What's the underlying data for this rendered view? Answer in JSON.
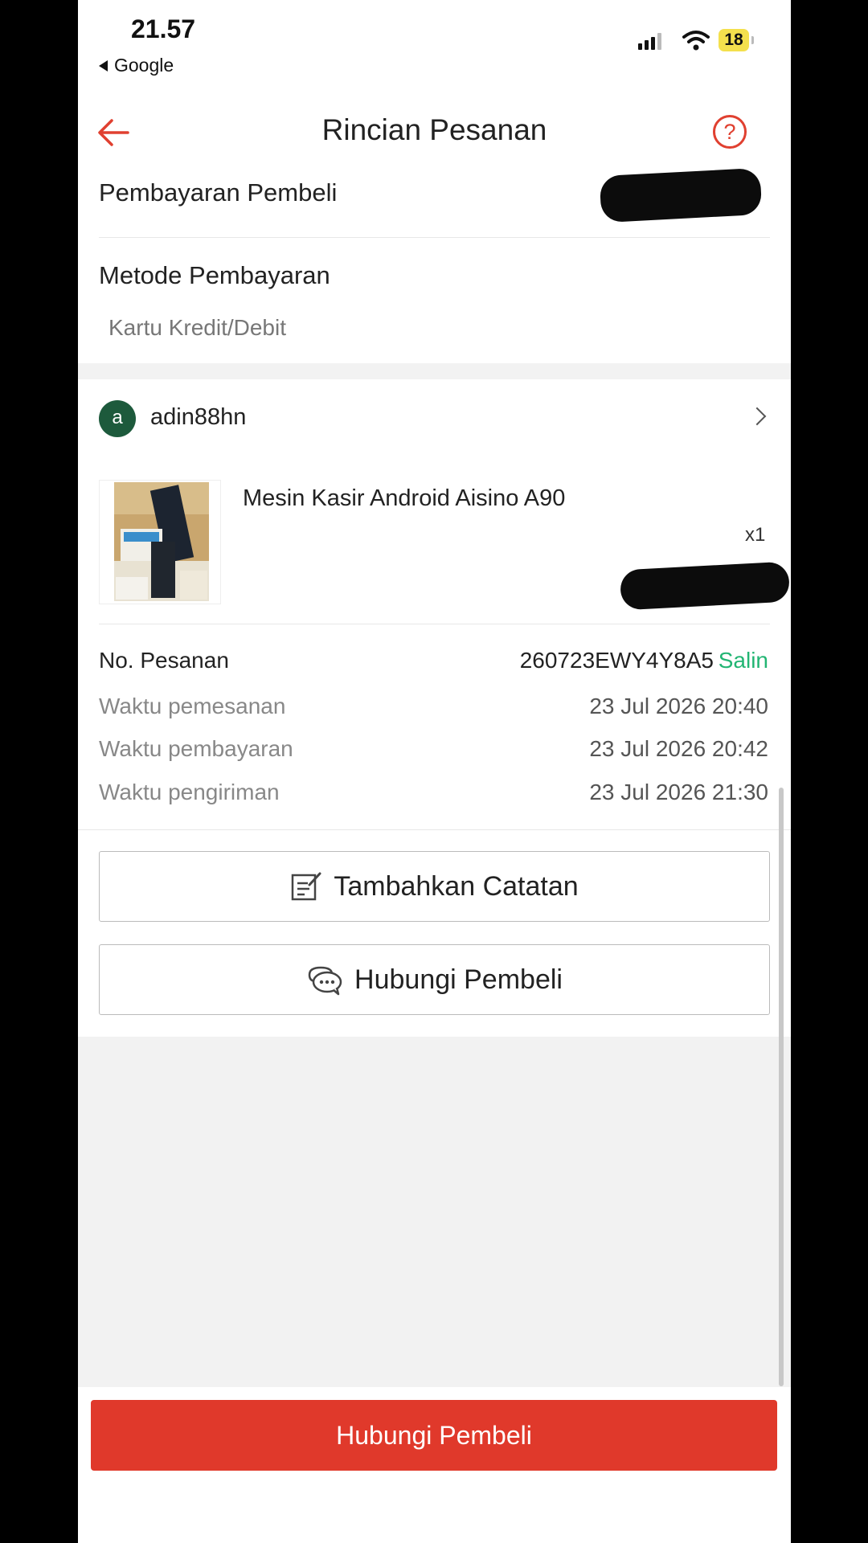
{
  "status_bar": {
    "time": "21.57",
    "back_app": "Google",
    "battery": "18"
  },
  "header": {
    "title": "Rincian Pesanan",
    "help_glyph": "?"
  },
  "payment": {
    "buyer_payment_label": "Pembayaran Pembeli",
    "method_label": "Metode Pembayaran",
    "method_value": "Kartu Kredit/Debit"
  },
  "shop": {
    "avatar_letter": "a",
    "name": "adin88hn"
  },
  "product": {
    "name": "Mesin Kasir Android Aisino A90",
    "quantity": "x1"
  },
  "order": {
    "number_label": "No. Pesanan",
    "number_value": "260723EWY4Y8A5",
    "copy_label": "Salin",
    "rows": [
      {
        "label": "Waktu pemesanan",
        "value": "23 Jul 2026 20:40"
      },
      {
        "label": "Waktu pembayaran",
        "value": "23 Jul 2026 20:42"
      },
      {
        "label": "Waktu pengiriman",
        "value": "23 Jul 2026 21:30"
      }
    ]
  },
  "actions": {
    "add_note_label": "Tambahkan Catatan",
    "contact_buyer_label": "Hubungi Pembeli",
    "primary_label": "Hubungi Pembeli"
  },
  "colors": {
    "accent": "#e0392b",
    "link": "#22b573",
    "avatar": "#1d5a3c"
  },
  "icons": [
    "back-arrow-icon",
    "help-icon",
    "chevron-right-icon",
    "note-icon",
    "chat-icon",
    "signal-icon",
    "wifi-icon",
    "battery-icon"
  ]
}
